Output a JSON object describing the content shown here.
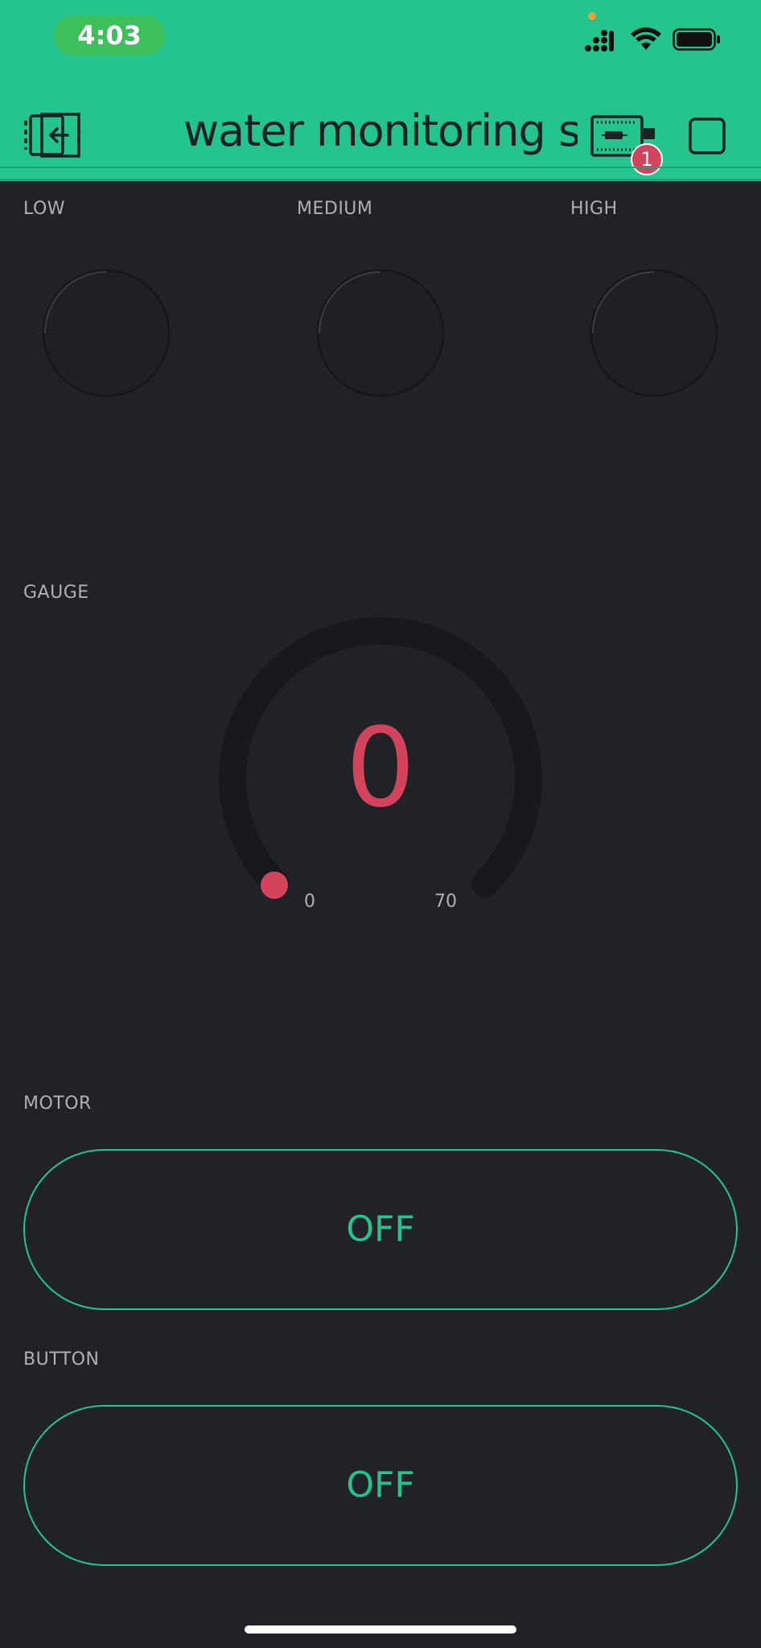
{
  "status_bar": {
    "time": "4:03",
    "signal_icon": "cellular-signal-icon",
    "wifi_icon": "wifi-icon",
    "battery_icon": "battery-full-icon"
  },
  "header": {
    "title": "water monitoring system",
    "back_icon": "exit-icon",
    "device_icon": "device-board-icon",
    "device_badge": "1",
    "stop_icon": "stop-square-icon",
    "background_color": "#23C48E"
  },
  "leds": [
    {
      "label": "LOW"
    },
    {
      "label": "MEDIUM"
    },
    {
      "label": "HIGH"
    }
  ],
  "gauge": {
    "label": "GAUGE",
    "value": "0",
    "min": "0",
    "max": "70",
    "accent_color": "#D3435C"
  },
  "motor": {
    "label": "MOTOR",
    "state": "OFF"
  },
  "button": {
    "label": "BUTTON",
    "state": "OFF"
  },
  "colors": {
    "background": "#212227",
    "accent": "#23C48E",
    "danger": "#D3435C",
    "label_text": "#AEB0B5"
  }
}
